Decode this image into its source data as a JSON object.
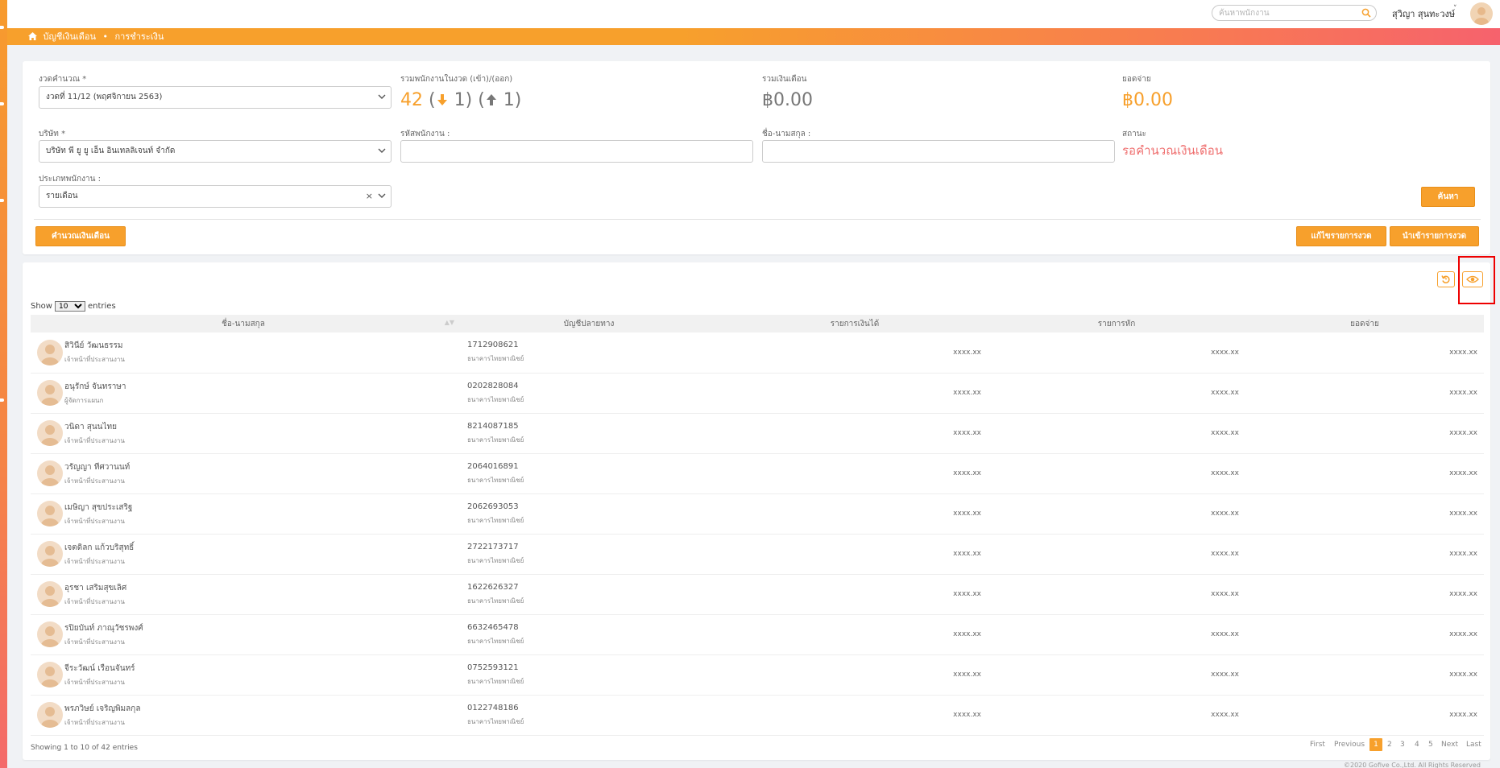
{
  "topbar": {
    "search_placeholder": "ค้นหาพนักงาน",
    "user_name": "สุวิญา สุนทะวงษ์",
    "user_caret": "˅"
  },
  "breadcrumb": {
    "root": "บัญชีเงินเดือน",
    "separator": "•",
    "current": "การชำระเงิน"
  },
  "filters": {
    "period_label": "งวดคำนวณ *",
    "period_value": "งวดที่ 11/12 (พฤศจิกายน 2563)",
    "company_label": "บริษัท *",
    "company_value": "บริษัท พี ยู ยู เอ็น อินเทลลิเจนท์ จำกัด",
    "employee_type_label": "ประเภทพนักงาน :",
    "employee_type_value": "รายเดือน",
    "employee_code_label": "รหัสพนักงาน :",
    "fullname_label": "ชื่อ-นามสกุล :",
    "status_label": "สถานะ",
    "status_value": "รอคำนวณเงินเดือน"
  },
  "stats": {
    "employees_label": "รวมพนักงานในงวด (เข้า)/(ออก)",
    "employees_total": "42",
    "employees_in": "1)",
    "employees_out": "1)",
    "open_paren": "(",
    "salary_label": "รวมเงินเดือน",
    "salary_total": "฿0.00",
    "payout_label": "ยอดจ่าย",
    "payout_total": "฿0.00"
  },
  "buttons": {
    "search": "ค้นหา",
    "calculate": "คำนวณเงินเดือน",
    "edit_period": "แก้ไขรายการงวด",
    "import_period": "นำเข้ารายการงวด"
  },
  "table": {
    "show_label": "Show",
    "entries_label": "entries",
    "page_length": "10",
    "columns": [
      "ชื่อ-นามสกุล",
      "บัญชีปลายทาง",
      "รายการเงินได้",
      "รายการหัก",
      "ยอดจ่าย"
    ],
    "rows": [
      {
        "name": "สิวินีย์ วัฒนธรรม",
        "position": "เจ้าหน้าที่ประสานงาน",
        "account": "1712908621",
        "bank": "ธนาคารไทยพาณิชย์",
        "income": "xxxx.xx",
        "deduction": "xxxx.xx",
        "net": "xxxx.xx"
      },
      {
        "name": "อนุรักษ์ จันทราษา",
        "position": "ผู้จัดการแผนก",
        "account": "0202828084",
        "bank": "ธนาคารไทยพาณิชย์",
        "income": "xxxx.xx",
        "deduction": "xxxx.xx",
        "net": "xxxx.xx"
      },
      {
        "name": "วนิดา สุนนไทย",
        "position": "เจ้าหน้าที่ประสานงาน",
        "account": "8214087185",
        "bank": "ธนาคารไทยพาณิชย์",
        "income": "xxxx.xx",
        "deduction": "xxxx.xx",
        "net": "xxxx.xx"
      },
      {
        "name": "วรัญญา ทีศวานนท์",
        "position": "เจ้าหน้าที่ประสานงาน",
        "account": "2064016891",
        "bank": "ธนาคารไทยพาณิชย์",
        "income": "xxxx.xx",
        "deduction": "xxxx.xx",
        "net": "xxxx.xx"
      },
      {
        "name": "เมษิญา สุขประเสริฐ",
        "position": "เจ้าหน้าที่ประสานงาน",
        "account": "2062693053",
        "bank": "ธนาคารไทยพาณิชย์",
        "income": "xxxx.xx",
        "deduction": "xxxx.xx",
        "net": "xxxx.xx"
      },
      {
        "name": "เจตดิลก แก้วบริสุทธิ์",
        "position": "เจ้าหน้าที่ประสานงาน",
        "account": "2722173717",
        "bank": "ธนาคารไทยพาณิชย์",
        "income": "xxxx.xx",
        "deduction": "xxxx.xx",
        "net": "xxxx.xx"
      },
      {
        "name": "อุรชา เสริมสุขเลิศ",
        "position": "เจ้าหน้าที่ประสานงาน",
        "account": "1622626327",
        "bank": "ธนาคารไทยพาณิชย์",
        "income": "xxxx.xx",
        "deduction": "xxxx.xx",
        "net": "xxxx.xx"
      },
      {
        "name": "รปิยบันท์ ภาณุวัชรพงศ์",
        "position": "เจ้าหน้าที่ประสานงาน",
        "account": "6632465478",
        "bank": "ธนาคารไทยพาณิชย์",
        "income": "xxxx.xx",
        "deduction": "xxxx.xx",
        "net": "xxxx.xx"
      },
      {
        "name": "จีระวัฒน์ เรือนจันทร์",
        "position": "เจ้าหน้าที่ประสานงาน",
        "account": "0752593121",
        "bank": "ธนาคารไทยพาณิชย์",
        "income": "xxxx.xx",
        "deduction": "xxxx.xx",
        "net": "xxxx.xx"
      },
      {
        "name": "พรภวิษย์ เจริญพิมลกุล",
        "position": "เจ้าหน้าที่ประสานงาน",
        "account": "0122748186",
        "bank": "ธนาคารไทยพาณิชย์",
        "income": "xxxx.xx",
        "deduction": "xxxx.xx",
        "net": "xxxx.xx"
      }
    ],
    "info": "Showing 1 to 10 of 42 entries"
  },
  "pagination": {
    "first": "First",
    "previous": "Previous",
    "pages": [
      "1",
      "2",
      "3",
      "4",
      "5"
    ],
    "current_page": "1",
    "next": "Next",
    "last": "Last"
  },
  "footer": {
    "copyright": "©2020 Gofive Co.,Ltd. All Rights Reserved"
  },
  "colors": {
    "accent": "#f7a02c",
    "gradient_end": "#f6626d",
    "status": "#ef6f6f",
    "highlight": "#e00000"
  },
  "icons": {
    "search": "search-icon",
    "home": "home-icon",
    "arrow_down": "arrow-down-icon",
    "arrow_up": "arrow-up-icon",
    "chevron": "chevron-down-icon",
    "reset": "reset-icon",
    "view": "eye-icon"
  }
}
